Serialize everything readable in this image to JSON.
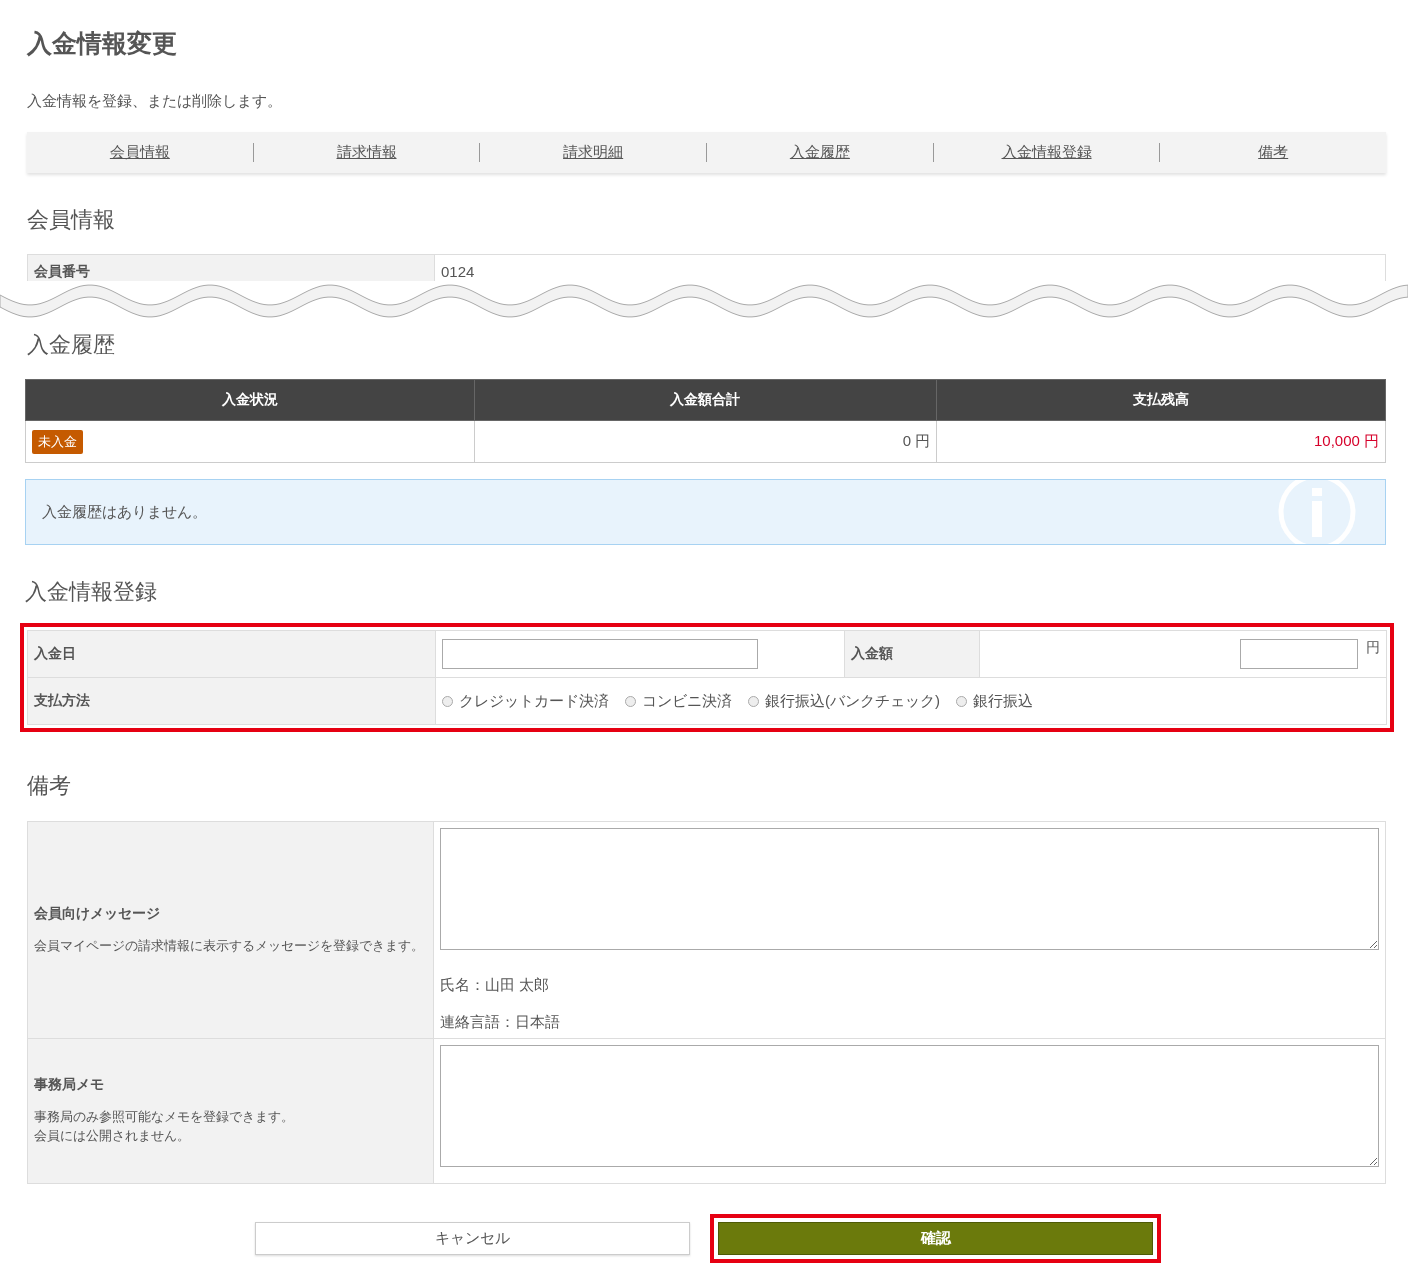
{
  "page": {
    "title": "入金情報変更",
    "description": "入金情報を登録、または削除します。"
  },
  "nav": [
    {
      "label": "会員情報"
    },
    {
      "label": "請求情報"
    },
    {
      "label": "請求明細"
    },
    {
      "label": "入金履歴"
    },
    {
      "label": "入金情報登録"
    },
    {
      "label": "備考"
    }
  ],
  "member_section": {
    "heading": "会員情報",
    "rows": [
      {
        "label": "会員番号",
        "value": "0124"
      }
    ]
  },
  "history_section": {
    "heading": "入金履歴",
    "columns": [
      "入金状況",
      "入金額合計",
      "支払残高"
    ],
    "rows": [
      {
        "status": {
          "text": "未入金",
          "color": "#c55a00"
        },
        "total": "0 円",
        "balance": "10,000 円"
      }
    ],
    "notice": "入金履歴はありません。"
  },
  "registration_section": {
    "heading": "入金情報登録",
    "highlighted": true,
    "date_label": "入金日",
    "amount_label": "入金額",
    "amount_unit": "円",
    "method_label": "支払方法",
    "methods": [
      {
        "label": "クレジットカード決済",
        "selected": false
      },
      {
        "label": "コンビニ決済",
        "selected": false
      },
      {
        "label": "銀行振込(バンクチェック)",
        "selected": false
      },
      {
        "label": "銀行振込",
        "selected": false
      }
    ]
  },
  "notes_section": {
    "heading": "備考",
    "message": {
      "label": "会員向けメッセージ",
      "help": "会員マイページの請求情報に表示するメッセージを登録できます。",
      "lines": [
        "氏名：山田 太郎",
        "連絡言語：日本語"
      ]
    },
    "memo": {
      "label": "事務局メモ",
      "help_lines": [
        "事務局のみ参照可能なメモを登録できます。",
        "会員には公開されません。"
      ]
    }
  },
  "buttons": [
    {
      "label": "キャンセル",
      "kind": "cancel",
      "highlighted": false
    },
    {
      "label": "確認",
      "kind": "confirm",
      "highlighted": true
    }
  ]
}
